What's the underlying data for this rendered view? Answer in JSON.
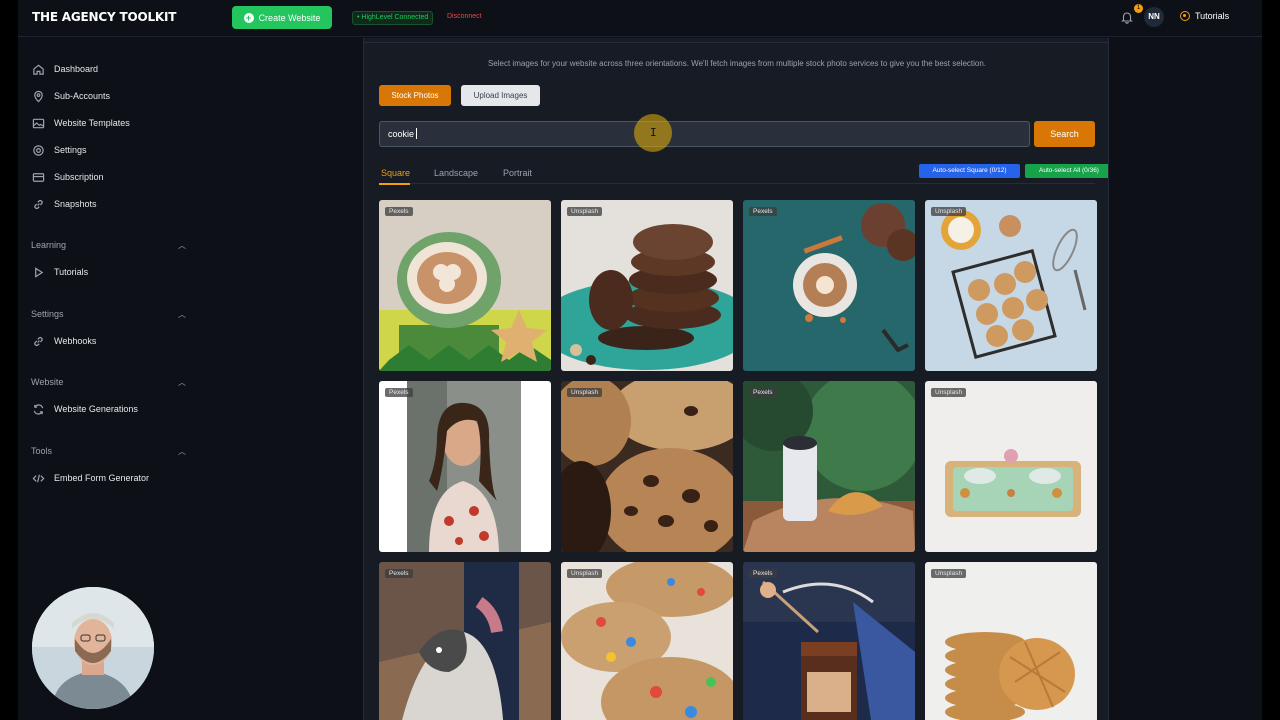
{
  "brand": "THE AGENCY TOOLKIT",
  "topbar": {
    "create_label": "Create Website",
    "connection_status": "• HighLevel Connected",
    "disconnect_label": "Disconnect",
    "notification_count": "1",
    "user_initials": "NN",
    "tutorials_label": "Tutorials"
  },
  "sidebar": {
    "items": [
      {
        "label": "Dashboard",
        "icon": "home-icon"
      },
      {
        "label": "Sub-Accounts",
        "icon": "map-pin-icon"
      },
      {
        "label": "Website Templates",
        "icon": "image-icon"
      },
      {
        "label": "Settings",
        "icon": "gear-icon"
      },
      {
        "label": "Subscription",
        "icon": "card-icon"
      },
      {
        "label": "Snapshots",
        "icon": "link-icon"
      }
    ],
    "sections": [
      {
        "title": "Learning",
        "items": [
          {
            "label": "Tutorials",
            "icon": "play-icon"
          }
        ]
      },
      {
        "title": "Settings",
        "items": [
          {
            "label": "Webhooks",
            "icon": "link-icon"
          }
        ]
      },
      {
        "title": "Website",
        "items": [
          {
            "label": "Website Generations",
            "icon": "refresh-icon"
          }
        ]
      },
      {
        "title": "Tools",
        "items": [
          {
            "label": "Embed Form Generator",
            "icon": "code-icon"
          }
        ]
      }
    ]
  },
  "main": {
    "description": "Select images for your website across three orientations. We'll fetch images from multiple stock photo services to give you the best selection.",
    "stock_label": "Stock Photos",
    "upload_label": "Upload Images",
    "search_value": "cookie",
    "search_button": "Search",
    "tabs": [
      "Square",
      "Landscape",
      "Portrait"
    ],
    "active_tab": "Square",
    "auto_square": "Auto-select Square (0/12)",
    "auto_all": "Auto-select All (0/36)",
    "images": [
      {
        "source": "Pexels"
      },
      {
        "source": "Unsplash"
      },
      {
        "source": "Pexels"
      },
      {
        "source": "Unsplash"
      },
      {
        "source": "Pexels"
      },
      {
        "source": "Unsplash"
      },
      {
        "source": "Pexels"
      },
      {
        "source": "Unsplash"
      },
      {
        "source": "Pexels"
      },
      {
        "source": "Unsplash"
      },
      {
        "source": "Pexels"
      },
      {
        "source": "Unsplash"
      }
    ]
  },
  "colors": {
    "accent": "#d97706",
    "success": "#22c55e",
    "primary": "#2563eb",
    "danger": "#ef4444",
    "background": "#0d1117",
    "panel": "#161b24"
  }
}
